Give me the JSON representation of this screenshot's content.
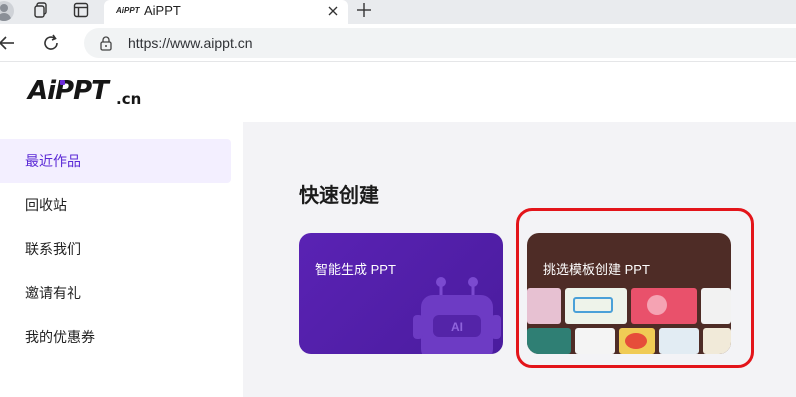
{
  "browser": {
    "tab_title": "AiPPT",
    "tab_favicon_text": "AiPPT",
    "url": "https://www.aippt.cn",
    "icons": [
      "profile-icon",
      "collections-icon",
      "tab-actions-icon",
      "close-icon",
      "new-tab-icon",
      "back-icon",
      "refresh-icon",
      "lock-icon"
    ]
  },
  "site": {
    "logo_text": "AiPPT",
    "logo_suffix": ".cn",
    "logo_accent": "#6c2bd9"
  },
  "sidebar": {
    "items": [
      {
        "label": "最近作品",
        "active": true
      },
      {
        "label": "回收站"
      },
      {
        "label": "联系我们"
      },
      {
        "label": "邀请有礼"
      },
      {
        "label": "我的优惠券"
      }
    ]
  },
  "main": {
    "section_title": "快速创建",
    "cards": [
      {
        "title": "智能生成 PPT",
        "badge": "AI",
        "color": "#5a22b4"
      },
      {
        "title": "挑选模板创建 PPT",
        "color": "#4e2c26"
      }
    ]
  },
  "colors": {
    "highlight": "#e3141a",
    "active_bg": "#f3efff",
    "active_text": "#5b2ad6"
  }
}
